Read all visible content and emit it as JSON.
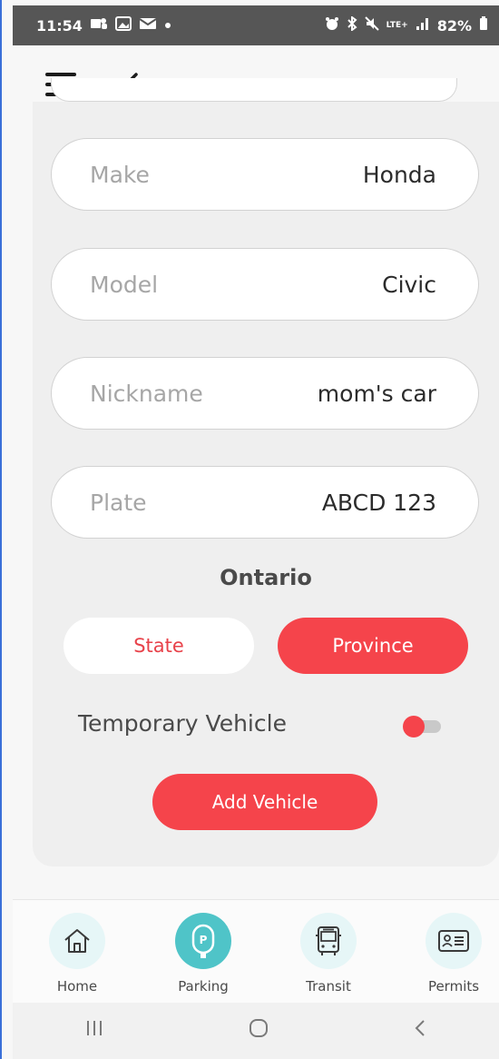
{
  "status_bar": {
    "time": "11:54",
    "left_icons": [
      "teams-icon",
      "photo-icon",
      "mail-icon",
      "dot-icon"
    ],
    "network": "LTE+",
    "battery": "82%"
  },
  "form": {
    "make": {
      "label": "Make",
      "value": "Honda"
    },
    "model": {
      "label": "Model",
      "value": "Civic"
    },
    "nickname": {
      "label": "Nickname",
      "value": "mom's car"
    },
    "plate": {
      "label": "Plate",
      "value": "ABCD 123"
    },
    "region": "Ontario",
    "region_type_options": [
      "State",
      "Province"
    ],
    "region_type_selected": "Province",
    "temporary_label": "Temporary Vehicle",
    "temporary_on": false,
    "submit_label": "Add Vehicle"
  },
  "bottom_nav": [
    {
      "label": "Home",
      "icon": "home-icon",
      "active": false
    },
    {
      "label": "Parking",
      "icon": "parking-meter-icon",
      "active": true
    },
    {
      "label": "Transit",
      "icon": "bus-icon",
      "active": false
    },
    {
      "label": "Permits",
      "icon": "id-card-icon",
      "active": false
    }
  ],
  "colors": {
    "accent": "#f5444b",
    "nav_active": "#4fc4c8",
    "nav_inactive": "#e6f6f7"
  }
}
